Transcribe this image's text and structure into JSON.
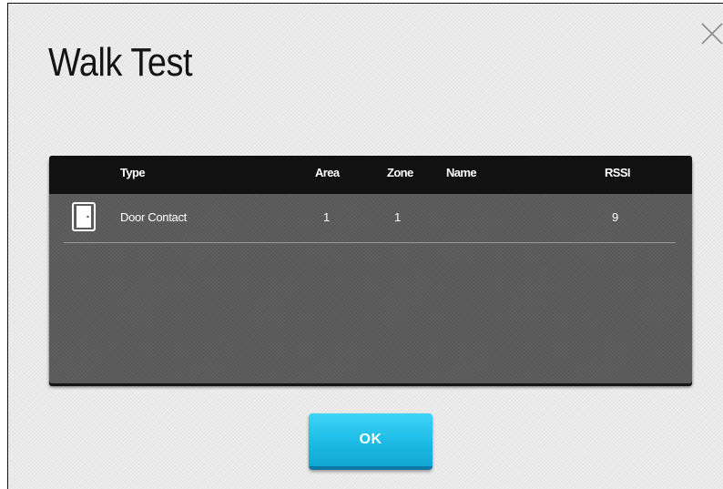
{
  "dialog": {
    "title": "Walk Test",
    "close_icon": "close-icon"
  },
  "table": {
    "columns": [
      "Type",
      "Area",
      "Zone",
      "Name",
      "RSSI"
    ],
    "rows": [
      {
        "icon": "door-icon",
        "type": "Door Contact",
        "area": "1",
        "zone": "1",
        "name": "",
        "rssi": "9"
      }
    ]
  },
  "actions": {
    "ok_label": "OK"
  },
  "colors": {
    "accent": "#1cbbe6",
    "header": "#111111",
    "table_body": "#5b5b5b"
  }
}
